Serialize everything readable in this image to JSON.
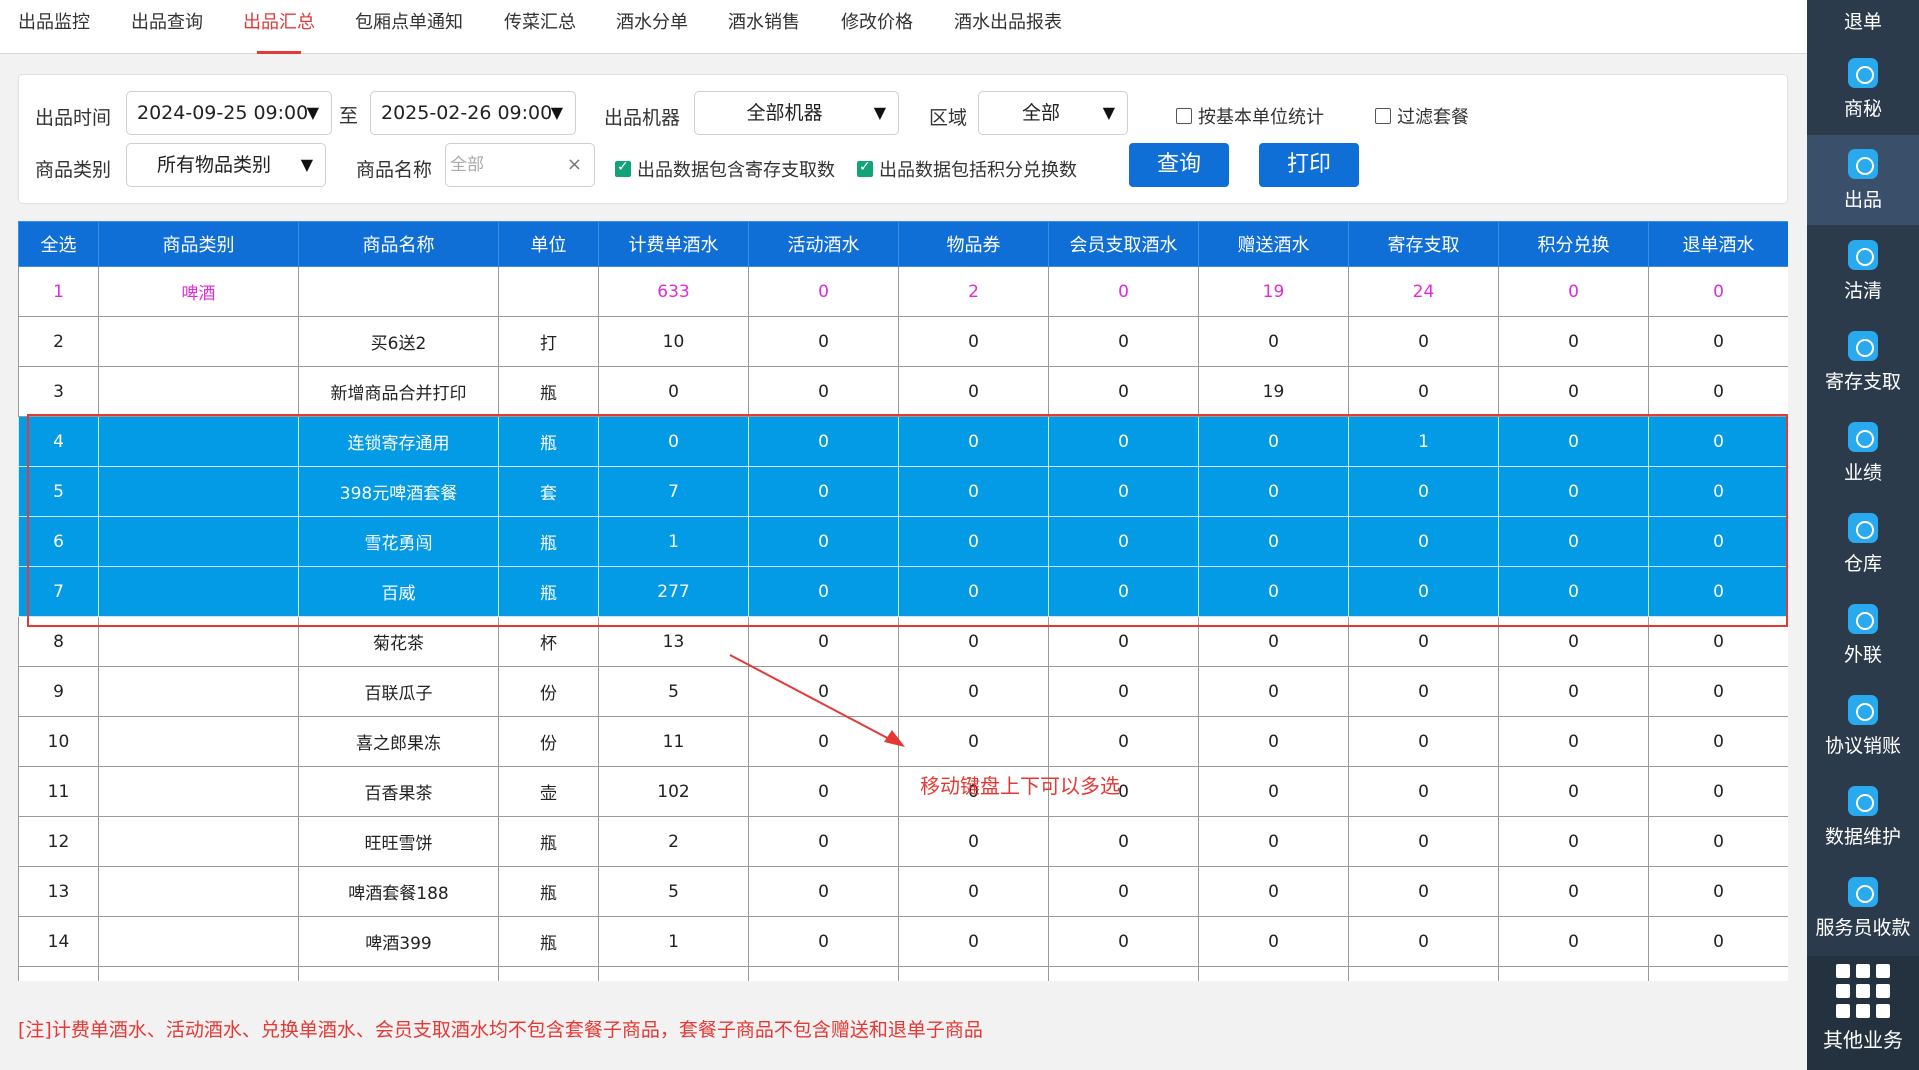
{
  "tabs": [
    "出品监控",
    "出品查询",
    "出品汇总",
    "包厢点单通知",
    "传菜汇总",
    "酒水分单",
    "酒水销售",
    "修改价格",
    "酒水出品报表"
  ],
  "active_tab": "出品汇总",
  "filter": {
    "time_label": "出品时间",
    "start": "2024-09-25 09:00",
    "to": "至",
    "end": "2025-02-26 09:00",
    "machine_label": "出品机器",
    "machine_value": "全部机器",
    "area_label": "区域",
    "area_value": "全部",
    "basic_unit": "按基本单位统计",
    "filter_combo": "过滤套餐",
    "category_label": "商品类别",
    "category_value": "所有物品类别",
    "name_label": "商品名称",
    "name_placeholder": "全部",
    "clear": "×",
    "include_deposit": "出品数据包含寄存支取数",
    "include_points": "出品数据包括积分兑换数",
    "query": "查询",
    "print": "打印"
  },
  "table": {
    "headers": [
      "全选",
      "商品类别",
      "商品名称",
      "单位",
      "计费单酒水",
      "活动酒水",
      "物品券",
      "会员支取酒水",
      "赠送酒水",
      "寄存支取",
      "积分兑换",
      "退单酒水"
    ],
    "rows": [
      [
        "1",
        "啤酒",
        "",
        "",
        "633",
        "0",
        "2",
        "0",
        "19",
        "24",
        "0",
        "0"
      ],
      [
        "2",
        "",
        "买6送2",
        "打",
        "10",
        "0",
        "0",
        "0",
        "0",
        "0",
        "0",
        "0"
      ],
      [
        "3",
        "",
        "新增商品合并打印",
        "瓶",
        "0",
        "0",
        "0",
        "0",
        "19",
        "0",
        "0",
        "0"
      ],
      [
        "4",
        "",
        "连锁寄存通用",
        "瓶",
        "0",
        "0",
        "0",
        "0",
        "0",
        "1",
        "0",
        "0"
      ],
      [
        "5",
        "",
        "398元啤酒套餐",
        "套",
        "7",
        "0",
        "0",
        "0",
        "0",
        "0",
        "0",
        "0"
      ],
      [
        "6",
        "",
        "雪花勇闯",
        "瓶",
        "1",
        "0",
        "0",
        "0",
        "0",
        "0",
        "0",
        "0"
      ],
      [
        "7",
        "",
        "百威",
        "瓶",
        "277",
        "0",
        "0",
        "0",
        "0",
        "0",
        "0",
        "0"
      ],
      [
        "8",
        "",
        "菊花茶",
        "杯",
        "13",
        "0",
        "0",
        "0",
        "0",
        "0",
        "0",
        "0"
      ],
      [
        "9",
        "",
        "百联瓜子",
        "份",
        "5",
        "0",
        "0",
        "0",
        "0",
        "0",
        "0",
        "0"
      ],
      [
        "10",
        "",
        "喜之郎果冻",
        "份",
        "11",
        "0",
        "0",
        "0",
        "0",
        "0",
        "0",
        "0"
      ],
      [
        "11",
        "",
        "百香果茶",
        "壶",
        "102",
        "0",
        "0",
        "0",
        "0",
        "0",
        "0",
        "0"
      ],
      [
        "12",
        "",
        "旺旺雪饼",
        "瓶",
        "2",
        "0",
        "0",
        "0",
        "0",
        "0",
        "0",
        "0"
      ],
      [
        "13",
        "",
        "啤酒套餐188",
        "瓶",
        "5",
        "0",
        "0",
        "0",
        "0",
        "0",
        "0",
        "0"
      ],
      [
        "14",
        "",
        "啤酒399",
        "瓶",
        "1",
        "0",
        "0",
        "0",
        "0",
        "0",
        "0",
        "0"
      ],
      [
        "",
        "",
        "",
        "",
        "",
        "",
        "",
        "",
        "",
        "",
        "",
        ""
      ]
    ],
    "selected_rows": [
      "4",
      "5",
      "6",
      "7"
    ],
    "category_row": "1"
  },
  "annotation": "移动键盘上下可以多选",
  "note": "[注]计费单酒水、活动酒水、兑换单酒水、会员支取酒水均不包含套餐子商品，套餐子商品不包含赠送和退单子商品",
  "sidebar": {
    "top": "退单",
    "items": [
      {
        "label": "商秘",
        "icon": "download-icon"
      },
      {
        "label": "出品",
        "icon": "upload-icon"
      },
      {
        "label": "沽清",
        "icon": "list-icon"
      },
      {
        "label": "寄存支取",
        "icon": "download-icon"
      },
      {
        "label": "业绩",
        "icon": "pie-chart-icon"
      },
      {
        "label": "仓库",
        "icon": "search-grid-icon"
      },
      {
        "label": "外联",
        "icon": "user-star-icon"
      },
      {
        "label": "协议销账",
        "icon": "download-icon"
      },
      {
        "label": "数据维护",
        "icon": "pie-chart-icon"
      },
      {
        "label": "服务员收款",
        "icon": "person-icon"
      }
    ],
    "active": "出品",
    "more": "其他业务"
  },
  "colors": {
    "primary": "#0f6fd6",
    "selected_row": "#039be5",
    "active_tab": "#e03a3a",
    "annotation": "#e53935",
    "magenta": "#e02bd8"
  }
}
